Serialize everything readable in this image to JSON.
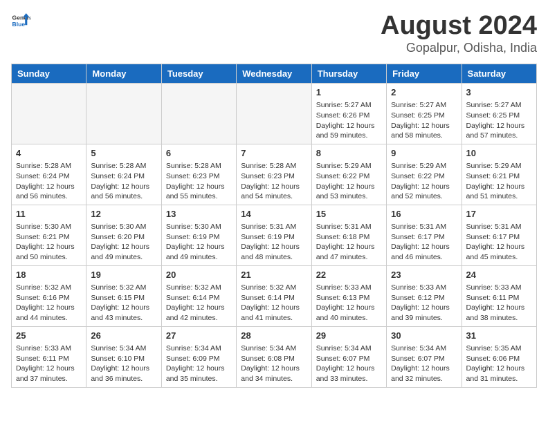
{
  "header": {
    "logo_general": "General",
    "logo_blue": "Blue",
    "title": "August 2024",
    "subtitle": "Gopalpur, Odisha, India"
  },
  "weekdays": [
    "Sunday",
    "Monday",
    "Tuesday",
    "Wednesday",
    "Thursday",
    "Friday",
    "Saturday"
  ],
  "weeks": [
    [
      {
        "day": "",
        "empty": true
      },
      {
        "day": "",
        "empty": true
      },
      {
        "day": "",
        "empty": true
      },
      {
        "day": "",
        "empty": true
      },
      {
        "day": "1",
        "sunrise": "5:27 AM",
        "sunset": "6:26 PM",
        "daylight": "12 hours and 59 minutes."
      },
      {
        "day": "2",
        "sunrise": "5:27 AM",
        "sunset": "6:25 PM",
        "daylight": "12 hours and 58 minutes."
      },
      {
        "day": "3",
        "sunrise": "5:27 AM",
        "sunset": "6:25 PM",
        "daylight": "12 hours and 57 minutes."
      }
    ],
    [
      {
        "day": "4",
        "sunrise": "5:28 AM",
        "sunset": "6:24 PM",
        "daylight": "12 hours and 56 minutes."
      },
      {
        "day": "5",
        "sunrise": "5:28 AM",
        "sunset": "6:24 PM",
        "daylight": "12 hours and 56 minutes."
      },
      {
        "day": "6",
        "sunrise": "5:28 AM",
        "sunset": "6:23 PM",
        "daylight": "12 hours and 55 minutes."
      },
      {
        "day": "7",
        "sunrise": "5:28 AM",
        "sunset": "6:23 PM",
        "daylight": "12 hours and 54 minutes."
      },
      {
        "day": "8",
        "sunrise": "5:29 AM",
        "sunset": "6:22 PM",
        "daylight": "12 hours and 53 minutes."
      },
      {
        "day": "9",
        "sunrise": "5:29 AM",
        "sunset": "6:22 PM",
        "daylight": "12 hours and 52 minutes."
      },
      {
        "day": "10",
        "sunrise": "5:29 AM",
        "sunset": "6:21 PM",
        "daylight": "12 hours and 51 minutes."
      }
    ],
    [
      {
        "day": "11",
        "sunrise": "5:30 AM",
        "sunset": "6:21 PM",
        "daylight": "12 hours and 50 minutes."
      },
      {
        "day": "12",
        "sunrise": "5:30 AM",
        "sunset": "6:20 PM",
        "daylight": "12 hours and 49 minutes."
      },
      {
        "day": "13",
        "sunrise": "5:30 AM",
        "sunset": "6:19 PM",
        "daylight": "12 hours and 49 minutes."
      },
      {
        "day": "14",
        "sunrise": "5:31 AM",
        "sunset": "6:19 PM",
        "daylight": "12 hours and 48 minutes."
      },
      {
        "day": "15",
        "sunrise": "5:31 AM",
        "sunset": "6:18 PM",
        "daylight": "12 hours and 47 minutes."
      },
      {
        "day": "16",
        "sunrise": "5:31 AM",
        "sunset": "6:17 PM",
        "daylight": "12 hours and 46 minutes."
      },
      {
        "day": "17",
        "sunrise": "5:31 AM",
        "sunset": "6:17 PM",
        "daylight": "12 hours and 45 minutes."
      }
    ],
    [
      {
        "day": "18",
        "sunrise": "5:32 AM",
        "sunset": "6:16 PM",
        "daylight": "12 hours and 44 minutes."
      },
      {
        "day": "19",
        "sunrise": "5:32 AM",
        "sunset": "6:15 PM",
        "daylight": "12 hours and 43 minutes."
      },
      {
        "day": "20",
        "sunrise": "5:32 AM",
        "sunset": "6:14 PM",
        "daylight": "12 hours and 42 minutes."
      },
      {
        "day": "21",
        "sunrise": "5:32 AM",
        "sunset": "6:14 PM",
        "daylight": "12 hours and 41 minutes."
      },
      {
        "day": "22",
        "sunrise": "5:33 AM",
        "sunset": "6:13 PM",
        "daylight": "12 hours and 40 minutes."
      },
      {
        "day": "23",
        "sunrise": "5:33 AM",
        "sunset": "6:12 PM",
        "daylight": "12 hours and 39 minutes."
      },
      {
        "day": "24",
        "sunrise": "5:33 AM",
        "sunset": "6:11 PM",
        "daylight": "12 hours and 38 minutes."
      }
    ],
    [
      {
        "day": "25",
        "sunrise": "5:33 AM",
        "sunset": "6:11 PM",
        "daylight": "12 hours and 37 minutes."
      },
      {
        "day": "26",
        "sunrise": "5:34 AM",
        "sunset": "6:10 PM",
        "daylight": "12 hours and 36 minutes."
      },
      {
        "day": "27",
        "sunrise": "5:34 AM",
        "sunset": "6:09 PM",
        "daylight": "12 hours and 35 minutes."
      },
      {
        "day": "28",
        "sunrise": "5:34 AM",
        "sunset": "6:08 PM",
        "daylight": "12 hours and 34 minutes."
      },
      {
        "day": "29",
        "sunrise": "5:34 AM",
        "sunset": "6:07 PM",
        "daylight": "12 hours and 33 minutes."
      },
      {
        "day": "30",
        "sunrise": "5:34 AM",
        "sunset": "6:07 PM",
        "daylight": "12 hours and 32 minutes."
      },
      {
        "day": "31",
        "sunrise": "5:35 AM",
        "sunset": "6:06 PM",
        "daylight": "12 hours and 31 minutes."
      }
    ]
  ]
}
